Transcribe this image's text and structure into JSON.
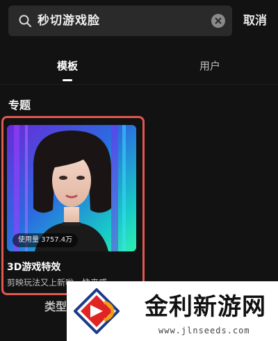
{
  "search": {
    "query": "秒切游戏脸",
    "cancel_label": "取消"
  },
  "tabs": [
    {
      "label": "模板",
      "active": true
    },
    {
      "label": "用户",
      "active": false
    }
  ],
  "section": {
    "title": "专题"
  },
  "card": {
    "usage": "使用量 3757.4万",
    "title": "3D游戏特效",
    "description": "剪映玩法又上新啦，快来感"
  },
  "filter": {
    "label": "类型"
  },
  "watermark": {
    "name": "金利新游网",
    "url": "www.jlnseeds.com"
  },
  "colors": {
    "background": "#121212",
    "search_bg": "#2a2a2a",
    "highlight_border": "#e2574f"
  }
}
